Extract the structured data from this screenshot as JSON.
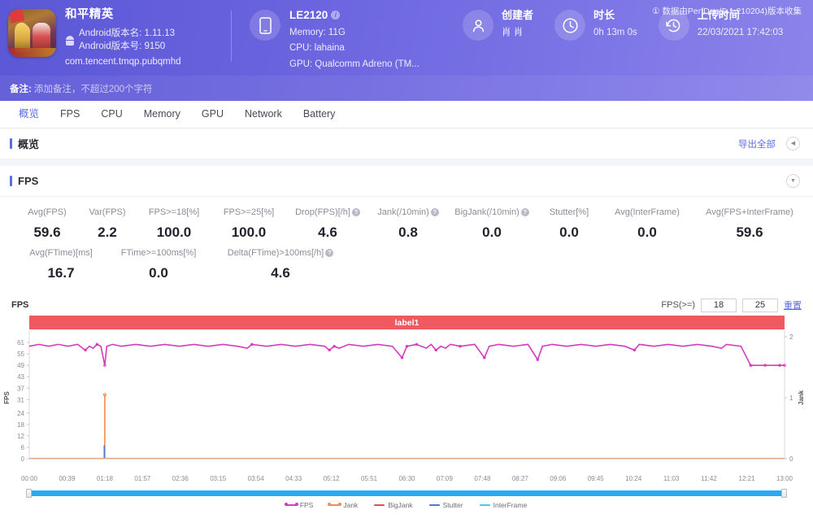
{
  "header": {
    "app": {
      "name": "和平精英",
      "android_version_name_label": "Android版本名: 1.11.13",
      "android_version_code_label": "Android版本号: 9150",
      "package": "com.tencent.tmqp.pubqmhd"
    },
    "device": {
      "model": "LE2120",
      "memory": "Memory: 11G",
      "cpu": "CPU: lahaina",
      "gpu": "GPU: Qualcomm Adreno (TM..."
    },
    "creator": {
      "title": "创建者",
      "value": "肖 肖"
    },
    "duration": {
      "title": "时长",
      "value": "0h 13m 0s"
    },
    "upload": {
      "title": "上传时间",
      "value": "22/03/2021 17:42:03"
    },
    "perfdog_note": "① 数据由PerfDog(5.1.210204)版本收集",
    "remark_label": "备注:",
    "remark_placeholder": "添加备注，不超过200个字符"
  },
  "tabs": [
    {
      "label": "概览",
      "active": true
    },
    {
      "label": "FPS",
      "active": false
    },
    {
      "label": "CPU",
      "active": false
    },
    {
      "label": "Memory",
      "active": false
    },
    {
      "label": "GPU",
      "active": false
    },
    {
      "label": "Network",
      "active": false
    },
    {
      "label": "Battery",
      "active": false
    }
  ],
  "overview_section": {
    "title": "概览",
    "export_label": "导出全部"
  },
  "fps_section": {
    "title": "FPS"
  },
  "metrics_row1": [
    {
      "label": "Avg(FPS)",
      "value": "59.6",
      "help": false
    },
    {
      "label": "Var(FPS)",
      "value": "2.2",
      "help": false
    },
    {
      "label": "FPS>=18[%]",
      "value": "100.0",
      "help": false
    },
    {
      "label": "FPS>=25[%]",
      "value": "100.0",
      "help": false
    },
    {
      "label": "Drop(FPS)[/h]",
      "value": "4.6",
      "help": true
    },
    {
      "label": "Jank(/10min)",
      "value": "0.8",
      "help": true
    },
    {
      "label": "BigJank(/10min)",
      "value": "0.0",
      "help": true
    },
    {
      "label": "Stutter[%]",
      "value": "0.0",
      "help": false
    },
    {
      "label": "Avg(InterFrame)",
      "value": "0.0",
      "help": false
    },
    {
      "label": "Avg(FPS+InterFrame)",
      "value": "59.6",
      "help": false
    }
  ],
  "metrics_row2": [
    {
      "label": "Avg(FTime)[ms]",
      "value": "16.7",
      "help": false
    },
    {
      "label": "FTime>=100ms[%]",
      "value": "0.0",
      "help": false
    },
    {
      "label": "Delta(FTime)>100ms[/h]",
      "value": "4.6",
      "help": true
    }
  ],
  "chart_controls": {
    "fps_threshold_label": "FPS(>=)",
    "threshold_low": "18",
    "threshold_high": "25",
    "reset_label": "重置"
  },
  "chart_data": {
    "type": "line",
    "title": "FPS",
    "annotation_band": "label1",
    "xlabel": "",
    "ylabel": "FPS",
    "y2label": "Jank",
    "ylim": [
      0,
      64
    ],
    "yticks": [
      0,
      6,
      12,
      18,
      24,
      31,
      37,
      43,
      49,
      55,
      61
    ],
    "y2lim": [
      0,
      2
    ],
    "y2ticks": [
      0,
      1,
      2
    ],
    "xticks": [
      "00:00",
      "00:39",
      "01:18",
      "01:57",
      "02:36",
      "03:15",
      "03:54",
      "04:33",
      "05:12",
      "05:51",
      "06:30",
      "07:09",
      "07:48",
      "08:27",
      "09:06",
      "09:45",
      "10:24",
      "11:03",
      "11:42",
      "12:21",
      "13:00"
    ],
    "xlim_seconds": [
      0,
      780
    ],
    "grid": false,
    "legend_position": "bottom",
    "series": [
      {
        "name": "FPS",
        "color": "#d43bbd",
        "points": [
          [
            0,
            59
          ],
          [
            10,
            60
          ],
          [
            20,
            59
          ],
          [
            30,
            60
          ],
          [
            40,
            59
          ],
          [
            50,
            60
          ],
          [
            55,
            58
          ],
          [
            58,
            57
          ],
          [
            62,
            59
          ],
          [
            66,
            58
          ],
          [
            70,
            60
          ],
          [
            74,
            59
          ],
          [
            78,
            49
          ],
          [
            80,
            59
          ],
          [
            86,
            60
          ],
          [
            95,
            59
          ],
          [
            110,
            60
          ],
          [
            125,
            59
          ],
          [
            140,
            60
          ],
          [
            155,
            59
          ],
          [
            170,
            60
          ],
          [
            185,
            59
          ],
          [
            200,
            60
          ],
          [
            215,
            59
          ],
          [
            225,
            58
          ],
          [
            230,
            60
          ],
          [
            245,
            59
          ],
          [
            260,
            60
          ],
          [
            275,
            59
          ],
          [
            290,
            60
          ],
          [
            305,
            59
          ],
          [
            310,
            57
          ],
          [
            315,
            59
          ],
          [
            320,
            58
          ],
          [
            330,
            60
          ],
          [
            345,
            59
          ],
          [
            360,
            60
          ],
          [
            375,
            59
          ],
          [
            385,
            53
          ],
          [
            390,
            59
          ],
          [
            400,
            60
          ],
          [
            410,
            58
          ],
          [
            415,
            60
          ],
          [
            420,
            57
          ],
          [
            425,
            59
          ],
          [
            430,
            58
          ],
          [
            435,
            60
          ],
          [
            445,
            59
          ],
          [
            460,
            60
          ],
          [
            470,
            53
          ],
          [
            475,
            59
          ],
          [
            485,
            60
          ],
          [
            500,
            59
          ],
          [
            515,
            60
          ],
          [
            525,
            52
          ],
          [
            530,
            59
          ],
          [
            540,
            60
          ],
          [
            555,
            59
          ],
          [
            570,
            60
          ],
          [
            585,
            59
          ],
          [
            600,
            60
          ],
          [
            615,
            59
          ],
          [
            625,
            57
          ],
          [
            630,
            60
          ],
          [
            645,
            59
          ],
          [
            660,
            60
          ],
          [
            675,
            59
          ],
          [
            690,
            60
          ],
          [
            705,
            59
          ],
          [
            715,
            58
          ],
          [
            720,
            60
          ],
          [
            735,
            59
          ],
          [
            745,
            49
          ],
          [
            760,
            49
          ],
          [
            775,
            49
          ],
          [
            780,
            49
          ]
        ]
      },
      {
        "name": "Jank",
        "color": "#f58a4b",
        "spike_time": 78,
        "spike_value": 1.05
      },
      {
        "name": "BigJank",
        "color": "#e8504f",
        "points": []
      },
      {
        "name": "Stutter",
        "color": "#4a78d8",
        "spike_time": 78,
        "spike_value": 0.22
      },
      {
        "name": "InterFrame",
        "color": "#4fc6e8",
        "points": []
      }
    ],
    "legend": [
      {
        "name": "FPS",
        "color": "#d43bbd",
        "marker": "dotted"
      },
      {
        "name": "Jank",
        "color": "#f58a4b",
        "marker": "dotted"
      },
      {
        "name": "BigJank",
        "color": "#e8504f",
        "marker": "line"
      },
      {
        "name": "Stutter",
        "color": "#4a78d8",
        "marker": "line"
      },
      {
        "name": "InterFrame",
        "color": "#4fc6e8",
        "marker": "line"
      }
    ]
  }
}
